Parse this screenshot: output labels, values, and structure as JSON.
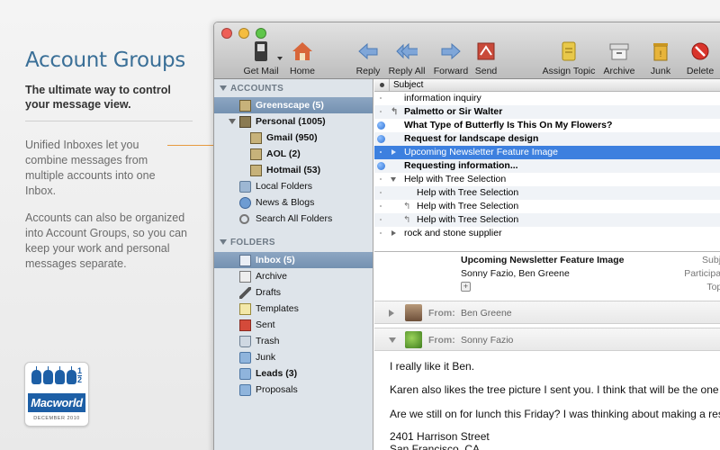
{
  "promo": {
    "title": "Account Groups",
    "tagline": "The ultimate way to control your message view.",
    "paragraph1": "Unified Inboxes let you combine messages from multiple accounts into one Inbox.",
    "paragraph2": "Accounts can also be organized into Account Groups, so you can keep your work and personal messages separate."
  },
  "badge": {
    "half": "1\n2",
    "brand": "Macworld",
    "date": "DECEMBER 2010"
  },
  "toolbar": {
    "get_mail": "Get Mail",
    "home": "Home",
    "reply": "Reply",
    "reply_all": "Reply All",
    "forward": "Forward",
    "send": "Send",
    "assign_topic": "Assign Topic",
    "archive": "Archive",
    "junk": "Junk",
    "delete": "Delete"
  },
  "sidebar": {
    "accounts_header": "ACCOUNTS",
    "folders_header": "FOLDERS",
    "accounts": [
      {
        "label": "Greenscape (5)"
      },
      {
        "label": "Personal (1005)"
      },
      {
        "label": "Gmail (950)"
      },
      {
        "label": "AOL (2)"
      },
      {
        "label": "Hotmail (53)"
      },
      {
        "label": "Local Folders"
      },
      {
        "label": "News & Blogs"
      },
      {
        "label": "Search All Folders"
      }
    ],
    "folders": [
      {
        "label": "Inbox (5)"
      },
      {
        "label": "Archive"
      },
      {
        "label": "Drafts"
      },
      {
        "label": "Templates"
      },
      {
        "label": "Sent"
      },
      {
        "label": "Trash"
      },
      {
        "label": "Junk"
      },
      {
        "label": "Leads (3)"
      },
      {
        "label": "Proposals"
      }
    ]
  },
  "list": {
    "column_subject": "Subject",
    "rows": [
      {
        "subject": "information inquiry"
      },
      {
        "subject": "Palmetto or Sir Walter"
      },
      {
        "subject": "What Type of Butterfly Is This On My Flowers?"
      },
      {
        "subject": "Request for landscape design"
      },
      {
        "subject": "Upcoming Newsletter Feature Image"
      },
      {
        "subject": "Requesting information..."
      },
      {
        "subject": "Help with Tree Selection"
      },
      {
        "subject": "Help with Tree Selection"
      },
      {
        "subject": "Help with Tree Selection"
      },
      {
        "subject": "Help with Tree Selection"
      },
      {
        "subject": "rock and stone supplier"
      }
    ]
  },
  "preview": {
    "subject_label": "Subject:",
    "subject": "Upcoming Newsletter Feature Image",
    "participants_label": "Participants:",
    "participants": "Sonny Fazio, Ben Greene",
    "topics_label": "Topics:",
    "topic_add": "+",
    "from_label": "From:",
    "from1": "Ben Greene",
    "from2": "Sonny Fazio",
    "body": [
      "I really like it Ben.",
      "Karen also likes the tree picture I sent you.  I think that will be the one I'll",
      "Are we still on for lunch this Friday? I was thinking about making a reserv",
      "2401 Harrison Street",
      "San Francisco, CA"
    ]
  },
  "colors": {
    "accent": "#3a6f97",
    "selection": "#3d80df",
    "sidebar_selection": "#7c98b8",
    "callout": "#e79a3f"
  }
}
